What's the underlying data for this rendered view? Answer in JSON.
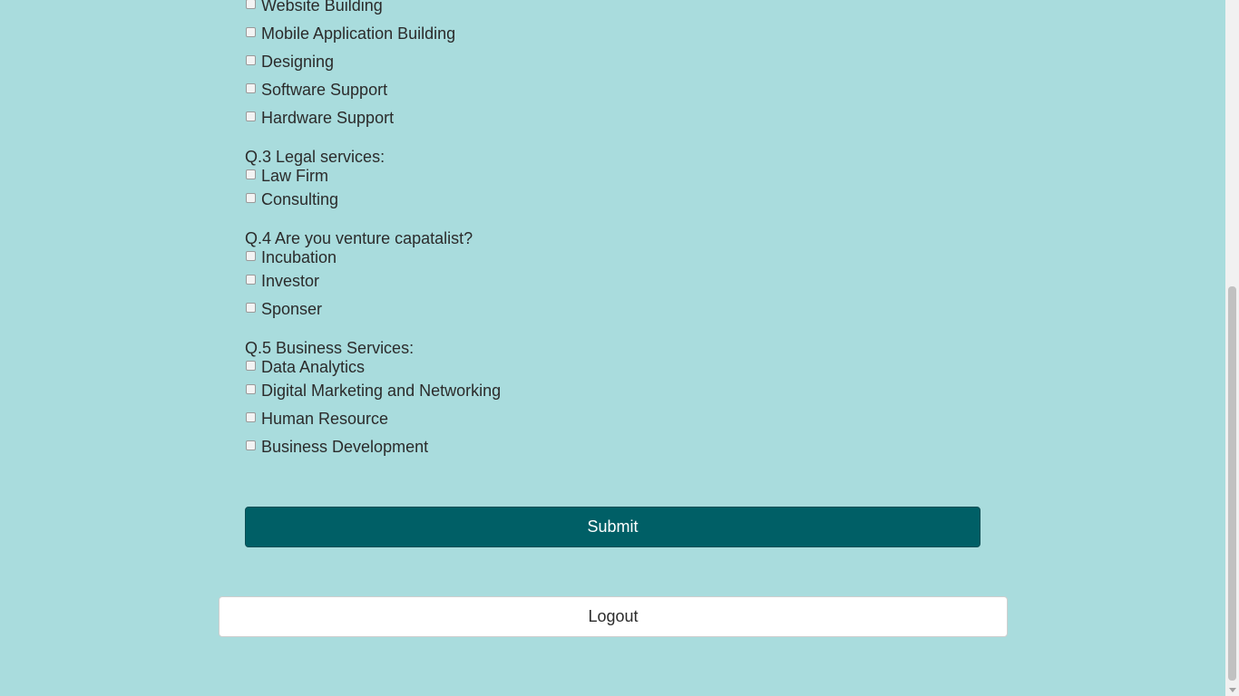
{
  "q2_options": [
    "Website Building",
    "Mobile Application Building",
    "Designing",
    "Software Support",
    "Hardware Support"
  ],
  "q3": {
    "label": "Q.3 Legal services:",
    "options": [
      "Law Firm",
      "Consulting"
    ]
  },
  "q4": {
    "label": "Q.4 Are you venture capatalist?",
    "options": [
      "Incubation",
      "Investor",
      "Sponser"
    ]
  },
  "q5": {
    "label": "Q.5 Business Services:",
    "options": [
      "Data Analytics",
      "Digital Marketing and Networking",
      "Human Resource",
      "Business Development"
    ]
  },
  "buttons": {
    "submit": "Submit",
    "logout": "Logout"
  },
  "colors": {
    "background": "#a9dcdd",
    "submit": "#005f66",
    "logout": "#ffffff"
  }
}
